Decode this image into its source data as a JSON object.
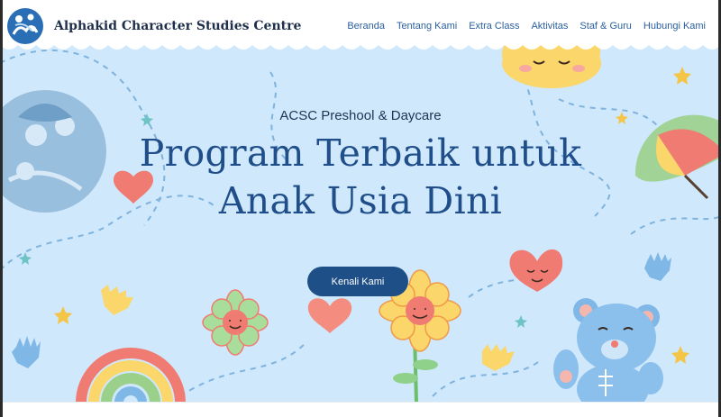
{
  "header": {
    "brand_name": "Alphakid Character Studies Centre",
    "logo_icon": "family-circle-logo-icon",
    "nav": [
      {
        "label": "Beranda"
      },
      {
        "label": "Tentang Kami"
      },
      {
        "label": "Extra Class"
      },
      {
        "label": "Aktivitas"
      },
      {
        "label": "Staf & Guru"
      },
      {
        "label": "Hubungi Kami"
      }
    ]
  },
  "hero": {
    "subtitle": "ACSC Preshool & Daycare",
    "title_line1": "Program Terbaik untuk",
    "title_line2": "Anak Usia Dini",
    "cta_label": "Kenali Kami"
  },
  "colors": {
    "hero_background": "#cfe8fb",
    "title": "#1f4e8a",
    "button": "#1e4f86",
    "nav_link": "#2a5f9e",
    "brand": "#1f2f4a"
  }
}
